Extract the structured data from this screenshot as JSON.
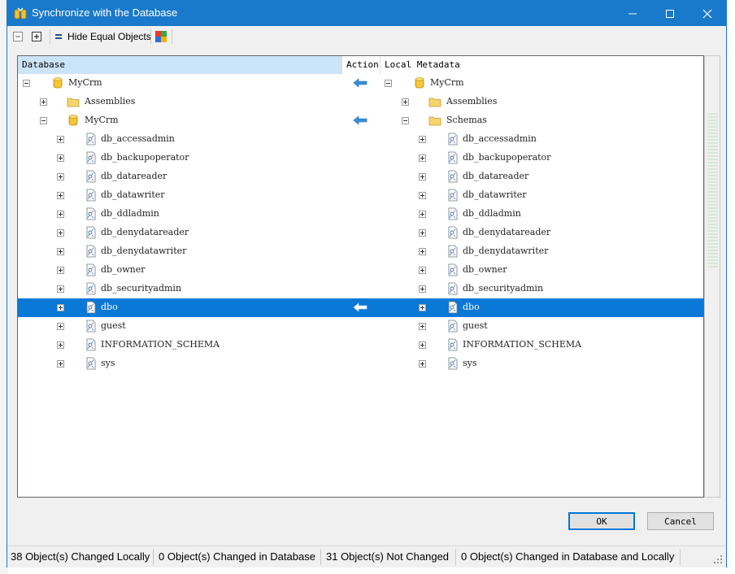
{
  "window": {
    "title": "Synchronize with the Database"
  },
  "toolbar": {
    "hide_equal_label": "Hide Equal Objects"
  },
  "columns": {
    "database": "Database",
    "action": "Action",
    "local": "Local Metadata"
  },
  "rows": [
    {
      "level": 0,
      "expanded": true,
      "icon": "database-icon",
      "db": "MyCrm",
      "local": "MyCrm",
      "action": "arrow-left-icon",
      "selected": false
    },
    {
      "level": 1,
      "expanded": false,
      "icon": "folder-icon",
      "db": "Assemblies",
      "local": "Assemblies",
      "action": "",
      "selected": false
    },
    {
      "level": 1,
      "expanded": true,
      "icon": "database-icon",
      "local_icon": "folder-icon",
      "db": "MyCrm",
      "local": "Schemas",
      "action": "arrow-left-icon",
      "selected": false
    },
    {
      "level": 2,
      "expanded": false,
      "icon": "schema-icon",
      "db": "db_accessadmin",
      "local": "db_accessadmin",
      "action": "",
      "selected": false
    },
    {
      "level": 2,
      "expanded": false,
      "icon": "schema-icon",
      "db": "db_backupoperator",
      "local": "db_backupoperator",
      "action": "",
      "selected": false
    },
    {
      "level": 2,
      "expanded": false,
      "icon": "schema-icon",
      "db": "db_datareader",
      "local": "db_datareader",
      "action": "",
      "selected": false
    },
    {
      "level": 2,
      "expanded": false,
      "icon": "schema-icon",
      "db": "db_datawriter",
      "local": "db_datawriter",
      "action": "",
      "selected": false
    },
    {
      "level": 2,
      "expanded": false,
      "icon": "schema-icon",
      "db": "db_ddladmin",
      "local": "db_ddladmin",
      "action": "",
      "selected": false
    },
    {
      "level": 2,
      "expanded": false,
      "icon": "schema-icon",
      "db": "db_denydatareader",
      "local": "db_denydatareader",
      "action": "",
      "selected": false
    },
    {
      "level": 2,
      "expanded": false,
      "icon": "schema-icon",
      "db": "db_denydatawriter",
      "local": "db_denydatawriter",
      "action": "",
      "selected": false
    },
    {
      "level": 2,
      "expanded": false,
      "icon": "schema-icon",
      "db": "db_owner",
      "local": "db_owner",
      "action": "",
      "selected": false
    },
    {
      "level": 2,
      "expanded": false,
      "icon": "schema-icon",
      "db": "db_securityadmin",
      "local": "db_securityadmin",
      "action": "",
      "selected": false
    },
    {
      "level": 2,
      "expanded": false,
      "icon": "schema-icon",
      "db": "dbo",
      "local": "dbo",
      "action": "arrow-left-icon",
      "selected": true
    },
    {
      "level": 2,
      "expanded": false,
      "icon": "schema-icon",
      "db": "guest",
      "local": "guest",
      "action": "",
      "selected": false
    },
    {
      "level": 2,
      "expanded": false,
      "icon": "schema-icon",
      "db": "INFORMATION_SCHEMA",
      "local": "INFORMATION_SCHEMA",
      "action": "",
      "selected": false
    },
    {
      "level": 2,
      "expanded": false,
      "icon": "schema-icon",
      "db": "sys",
      "local": "sys",
      "action": "",
      "selected": false
    }
  ],
  "buttons": {
    "ok": "OK",
    "cancel": "Cancel"
  },
  "status": [
    "38 Object(s) Changed Locally",
    "0 Object(s) Changed in Database",
    "31 Object(s) Not Changed",
    "0 Object(s) Changed in Database and Locally"
  ],
  "background_text": [
    "0)",
    "(0",
    "0)",
    "8",
    "0)",
    "",
    "",
    "",
    "",
    "",
    "",
    "",
    "",
    "",
    "",
    "",
    "",
    "",
    "",
    "",
    "",
    "",
    "",
    "",
    "",
    "",
    "",
    "",
    "",
    "",
    "",
    "",
    "",
    "",
    "",
    "",
    "",
    "",
    "",
    "",
    "",
    "",
    "",
    "",
    "",
    ""
  ],
  "colors": {
    "titlebar": "#1979ca",
    "selection": "#0a78d7",
    "arrow": "#3a8fd8"
  }
}
